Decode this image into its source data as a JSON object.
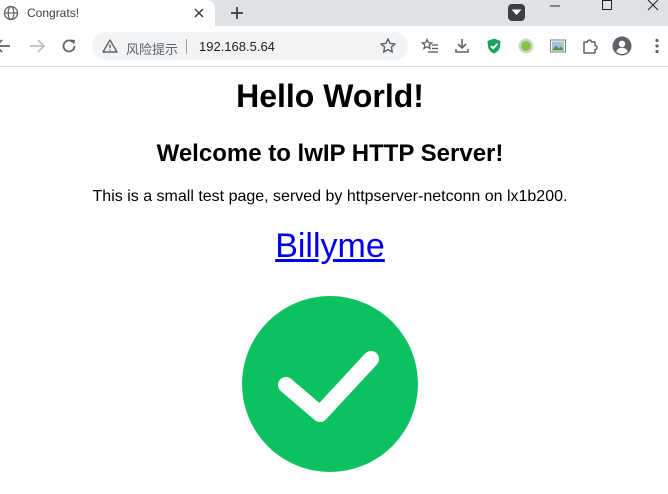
{
  "tab": {
    "title": "Congrats!",
    "icon": "globe-icon"
  },
  "toolbar": {
    "security_label": "风险提示",
    "url": "192.168.5.64"
  },
  "page": {
    "heading": "Hello World!",
    "subheading": "Welcome to lwIP HTTP Server!",
    "paragraph": "This is a small test page, served by httpserver-netconn on lx1b200.",
    "link_text": "Billyme"
  },
  "colors": {
    "check_circle": "#0bc160",
    "link": "#0000ee",
    "tabstrip": "#dee1e6",
    "omnibox": "#f1f3f4"
  }
}
